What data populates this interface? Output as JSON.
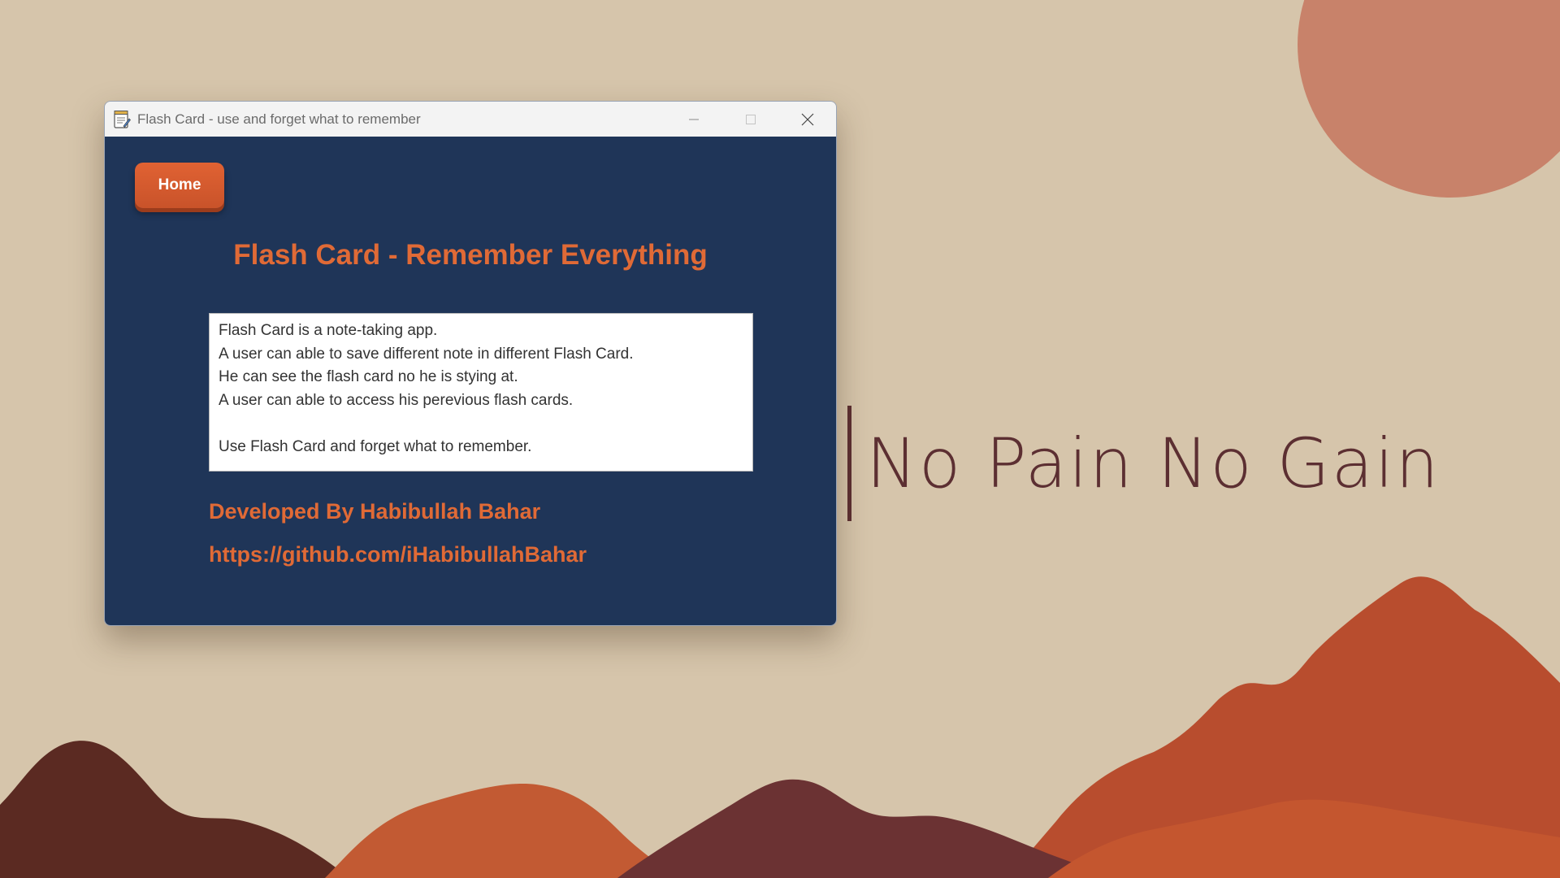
{
  "window": {
    "title": "Flash Card - use and forget what to remember",
    "minimize_icon": "minimize-icon",
    "maximize_icon": "maximize-icon",
    "close_icon": "close-icon"
  },
  "app": {
    "home_label": "Home",
    "heading": "Flash Card - Remember Everything",
    "description_lines": [
      "Flash Card is a note-taking app.",
      "A user can able to save different note in different Flash Card.",
      "He can see the flash card no he is stying at.",
      "A user can able to access his perevious flash cards.",
      "",
      "Use Flash Card and forget what to remember."
    ],
    "developer": "Developed By Habibullah Bahar",
    "link": "https://github.com/iHabibullahBahar"
  },
  "desktop": {
    "quote": "No Pain No Gain"
  },
  "colors": {
    "background": "#d6c5ab",
    "window_bg": "#1f3558",
    "accent": "#e06a36",
    "button": "#d65a2e",
    "quote": "#5c2f32"
  }
}
